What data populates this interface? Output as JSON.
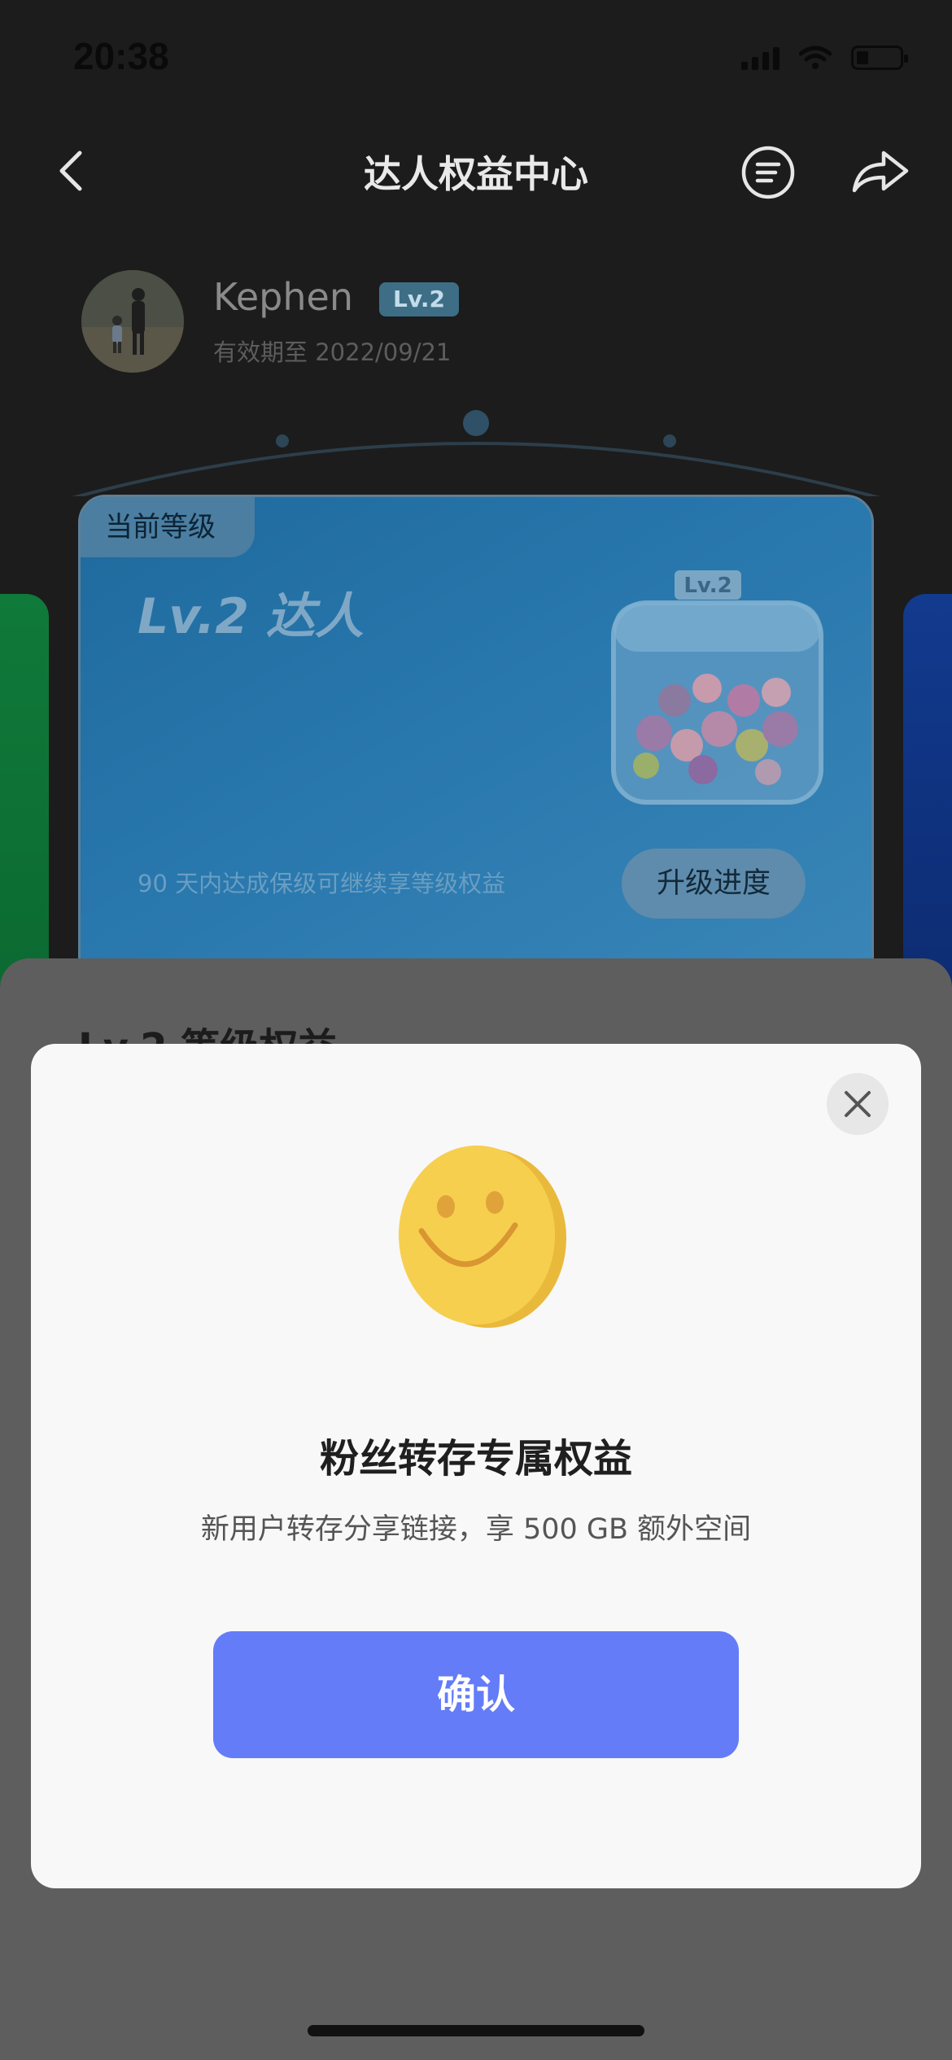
{
  "status_bar": {
    "time": "20:38",
    "icons": [
      "signal-icon",
      "wifi-icon",
      "battery-icon"
    ]
  },
  "nav": {
    "title": "达人权益中心",
    "back_icon": "chevron-left-icon",
    "menu_icon": "list-circle-icon",
    "share_icon": "share-arrow-icon"
  },
  "profile": {
    "username": "Kephen",
    "level_badge": "Lv.2",
    "validity": "有效期至 2022/09/21"
  },
  "level_card": {
    "current_tag": "当前等级",
    "title": "Lv.2 达人",
    "jar_badge": "Lv.2",
    "note": "90 天内达成保级可继续享等级权益",
    "upgrade_button": "升级进度"
  },
  "sheet": {
    "heading": "Lv.2 等级权益"
  },
  "modal": {
    "title": "粉丝转存专属权益",
    "description": "新用户转存分享链接，享 500 GB 额外空间",
    "confirm_button": "确认",
    "close_icon": "close-icon",
    "illustration": "smiley-face-icon"
  },
  "colors": {
    "confirm": "#647cf8",
    "card_blue": "#2877ad",
    "badge": "#3d6e86"
  }
}
